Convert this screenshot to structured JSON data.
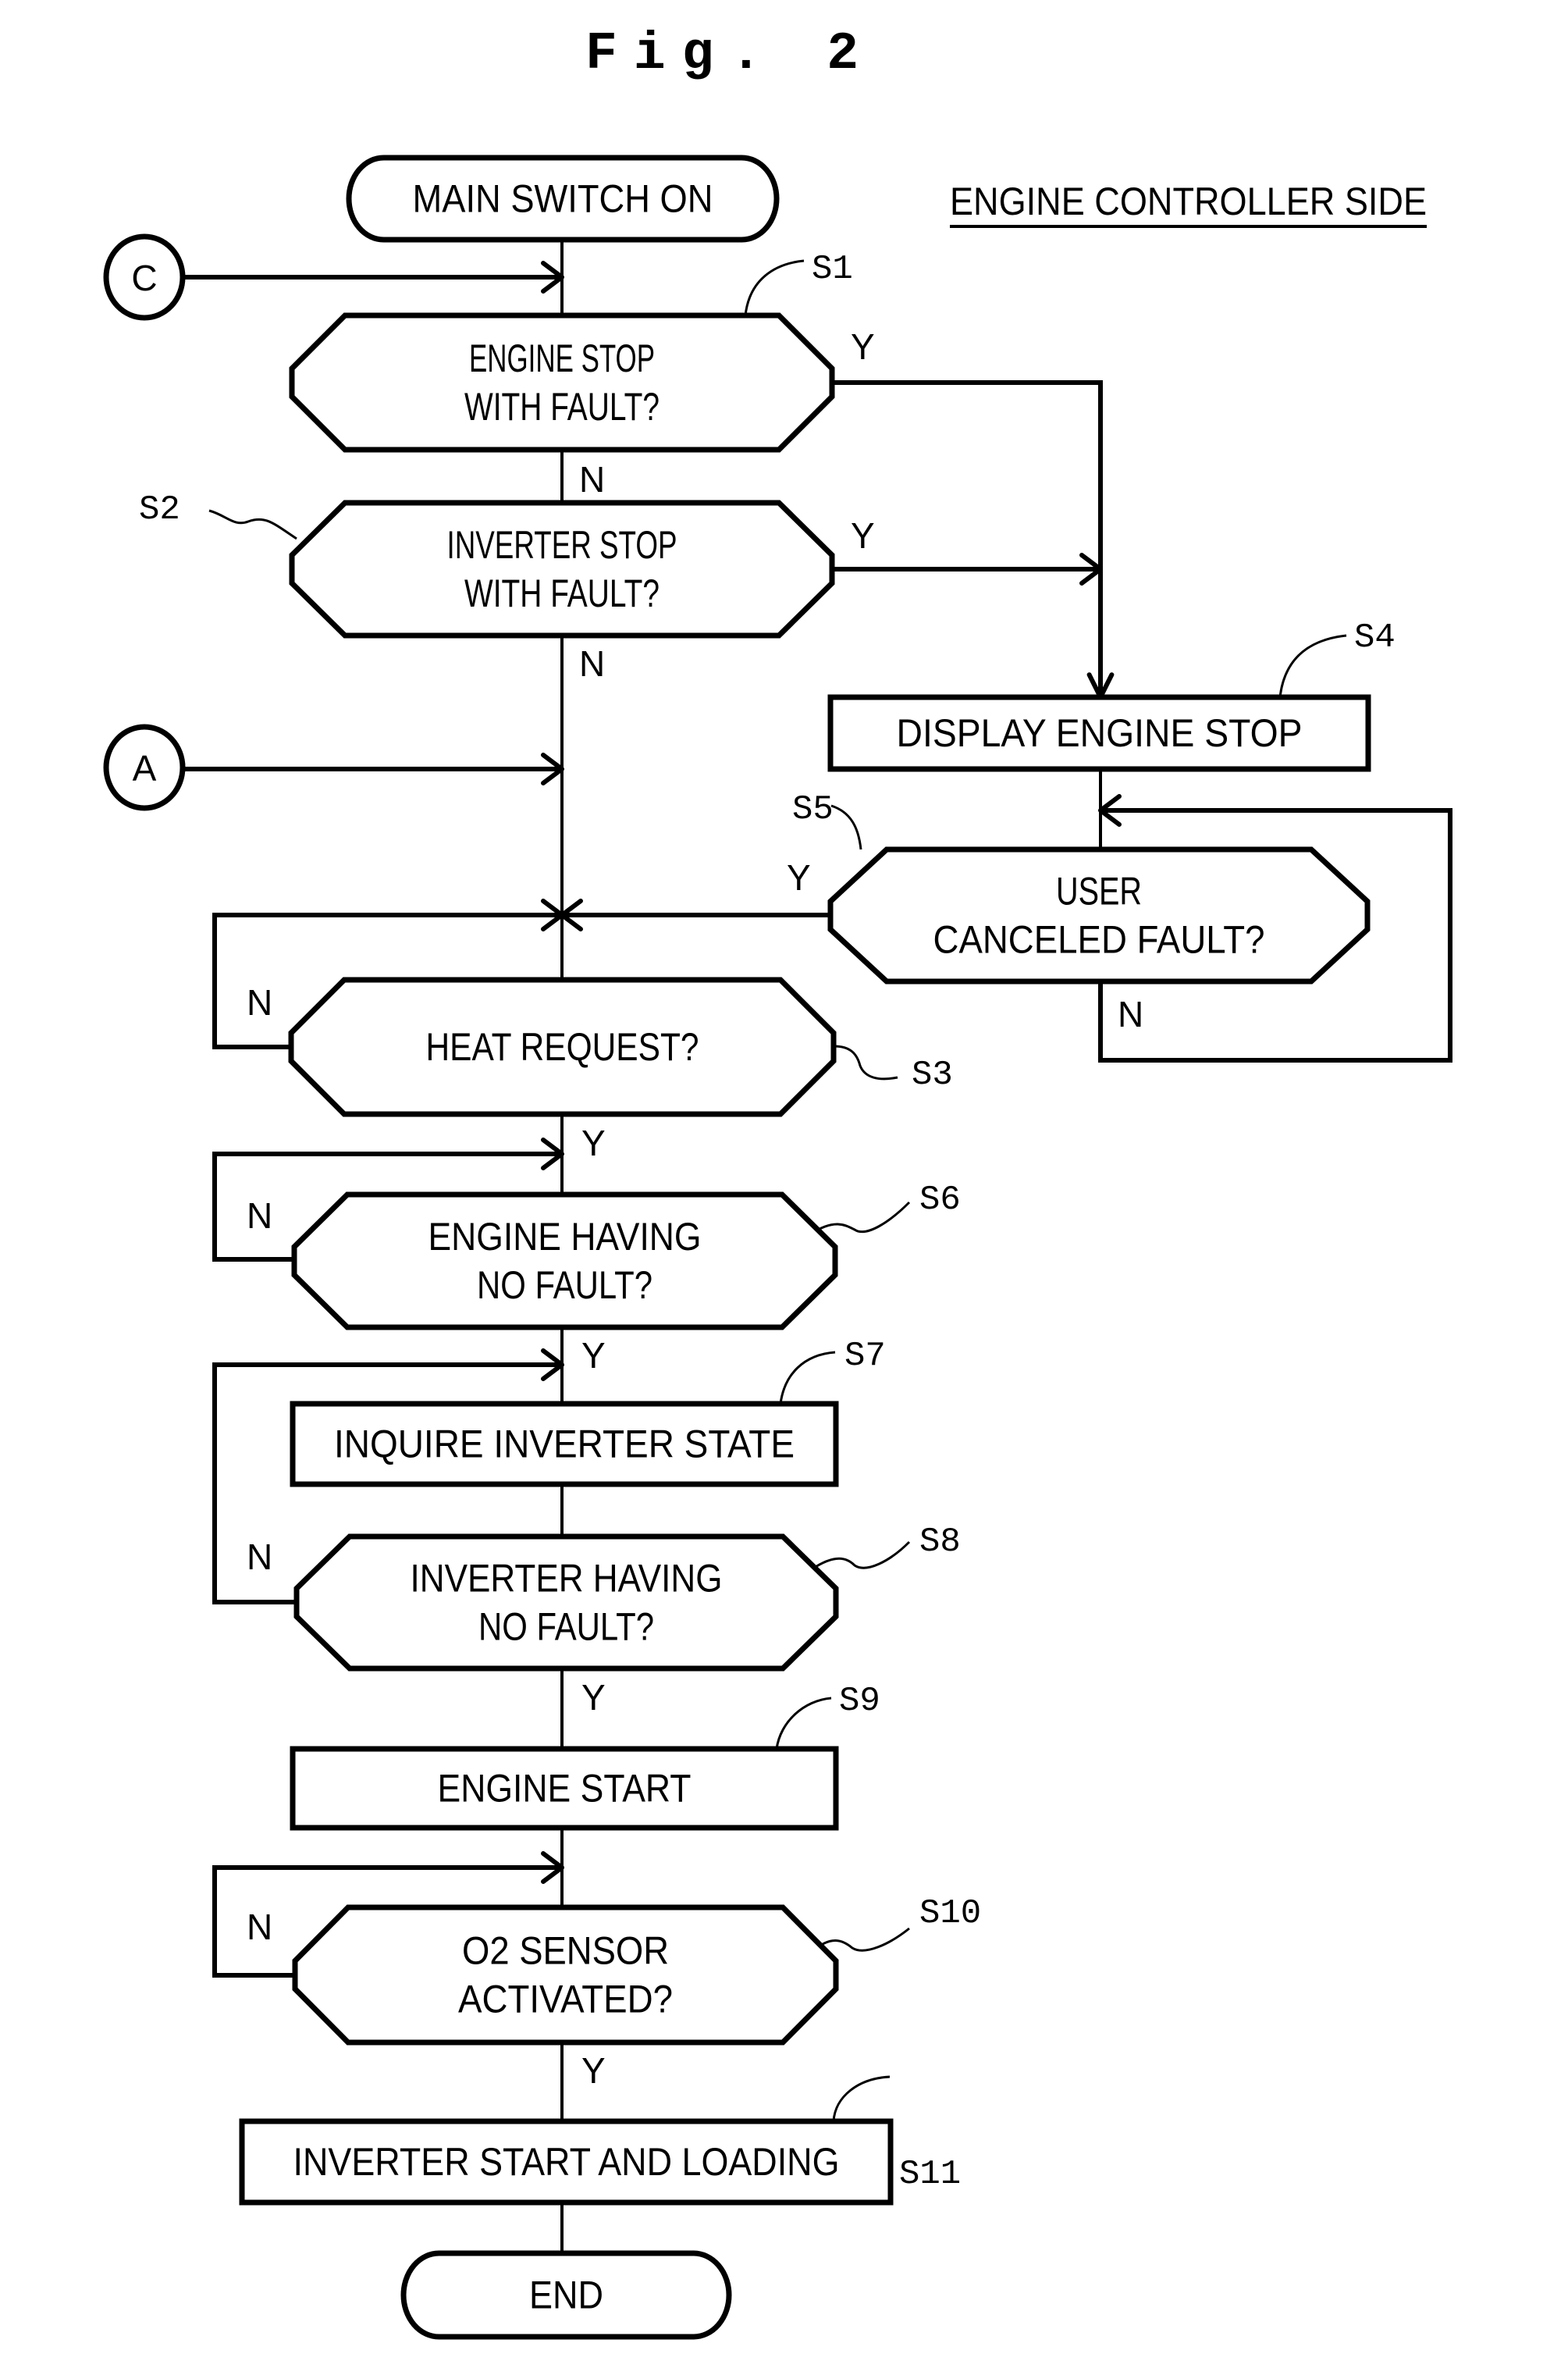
{
  "figure": {
    "title": "Fig. 2",
    "side_label": "ENGINE CONTROLLER SIDE"
  },
  "connectors": {
    "C": "C",
    "A": "A"
  },
  "nodes": {
    "start": {
      "text": [
        "MAIN SWITCH ON"
      ]
    },
    "s1": {
      "step": "S1",
      "text": [
        "ENGINE STOP",
        "WITH FAULT?"
      ],
      "yes": "Y",
      "no": "N"
    },
    "s2": {
      "step": "S2",
      "text": [
        "INVERTER STOP",
        "WITH FAULT?"
      ],
      "yes": "Y",
      "no": "N"
    },
    "s3": {
      "step": "S3",
      "text": [
        "HEAT REQUEST?"
      ],
      "yes": "Y",
      "no": "N"
    },
    "s4": {
      "step": "S4",
      "text": [
        "DISPLAY ENGINE STOP"
      ]
    },
    "s5": {
      "step": "S5",
      "text": [
        "USER",
        "CANCELED FAULT?"
      ],
      "yes": "Y",
      "no": "N"
    },
    "s6": {
      "step": "S6",
      "text": [
        "ENGINE HAVING",
        "NO FAULT?"
      ],
      "yes": "Y",
      "no": "N"
    },
    "s7": {
      "step": "S7",
      "text": [
        "INQUIRE  INVERTER STATE"
      ]
    },
    "s8": {
      "step": "S8",
      "text": [
        "INVERTER HAVING",
        "NO FAULT?"
      ],
      "yes": "Y",
      "no": "N"
    },
    "s9": {
      "step": "S9",
      "text": [
        "ENGINE START"
      ]
    },
    "s10": {
      "step": "S10",
      "text": [
        "O2 SENSOR",
        "ACTIVATED?"
      ],
      "yes": "Y",
      "no": "N"
    },
    "s11": {
      "step": "S11",
      "text": [
        "INVERTER START AND LOADING"
      ]
    },
    "end": {
      "text": [
        "END"
      ]
    }
  }
}
